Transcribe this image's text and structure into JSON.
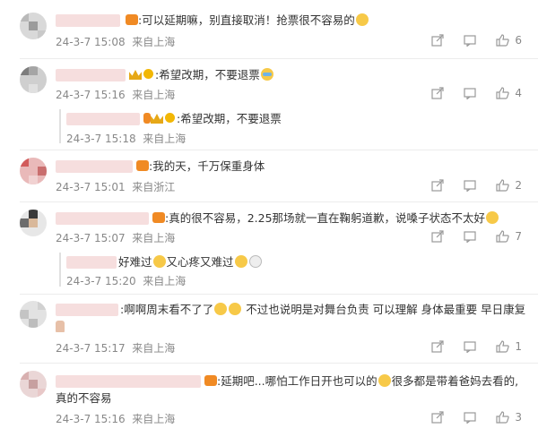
{
  "colors": {
    "meta": "#888888",
    "text": "#333333",
    "divider": "#ececec",
    "emoji": "#f7c948",
    "crown": "#e6a817",
    "badge": "#f08a24"
  },
  "comments": [
    {
      "text": ":可以延期嘛，别直接取消！抢票很不容易的",
      "date": "24-3-7 15:08",
      "location": "来自上海",
      "likes": "6"
    },
    {
      "text": ":希望改期，不要退票",
      "date": "24-3-7 15:16",
      "location": "来自上海",
      "likes": "4",
      "reply": {
        "text": ":希望改期，不要退票",
        "date": "24-3-7 15:18",
        "location": "来自上海"
      }
    },
    {
      "text": ":我的天，千万保重身体",
      "date": "24-3-7 15:01",
      "location": "来自浙江",
      "likes": "2"
    },
    {
      "text": ":真的很不容易，2.25那场就一直在鞠躬道歉，说嗓子状态不太好",
      "date": "24-3-7 15:07",
      "location": "来自上海",
      "likes": "7",
      "reply": {
        "text_a": "好难过",
        "text_b": "又心疼又难过",
        "date": "24-3-7 15:20",
        "location": "来自上海"
      }
    },
    {
      "text": ":啊啊周末看不了了",
      "text_tail": "不过也说明是对舞台负责 可以理解  身体最重要 早日康复",
      "date": "24-3-7 15:17",
      "location": "来自上海",
      "likes": "1"
    },
    {
      "text": ":延期吧...哪怕工作日开也可以的",
      "text_tail": "很多都是带着爸妈去看的,",
      "text_line2": "真的不容易",
      "date": "24-3-7 15:16",
      "location": "来自上海",
      "likes": "3"
    }
  ],
  "icons": {
    "share": "share-icon",
    "comment": "comment-icon",
    "like": "thumbs-up-icon"
  }
}
